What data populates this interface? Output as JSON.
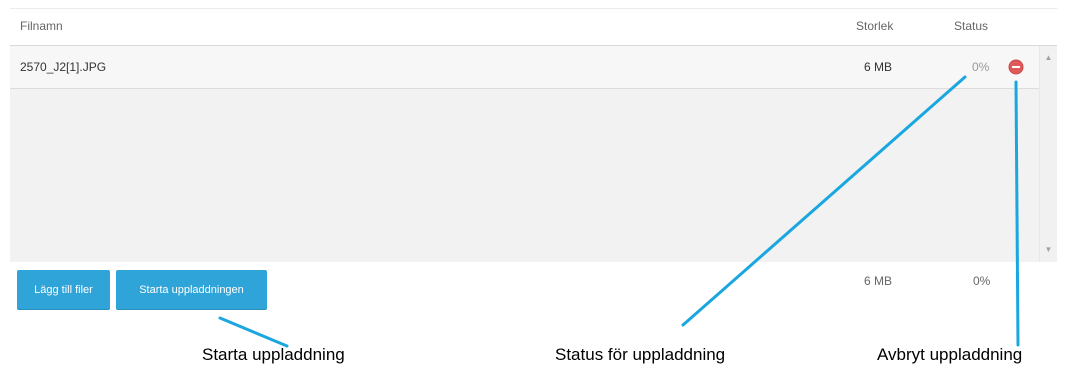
{
  "table": {
    "columns": {
      "name": "Filnamn",
      "size": "Storlek",
      "status": "Status"
    },
    "files": [
      {
        "name": "2570_J2[1].JPG",
        "size": "6 MB",
        "status": "0%",
        "progress_percent": 0,
        "cancel_icon": "minus-circle-icon"
      }
    ]
  },
  "footer": {
    "add_files_label": "Lägg till filer",
    "start_upload_label": "Starta uppladdningen",
    "total_size": "6 MB",
    "total_status": "0%"
  },
  "callouts": {
    "start_upload": "Starta uppladdning",
    "upload_status": "Status för uppladdning",
    "cancel_upload": "Avbryt uppladdning"
  },
  "colors": {
    "button": "#2fa4d8",
    "callout_line": "#1aa7e0",
    "cancel_icon": "#e05a5a"
  }
}
